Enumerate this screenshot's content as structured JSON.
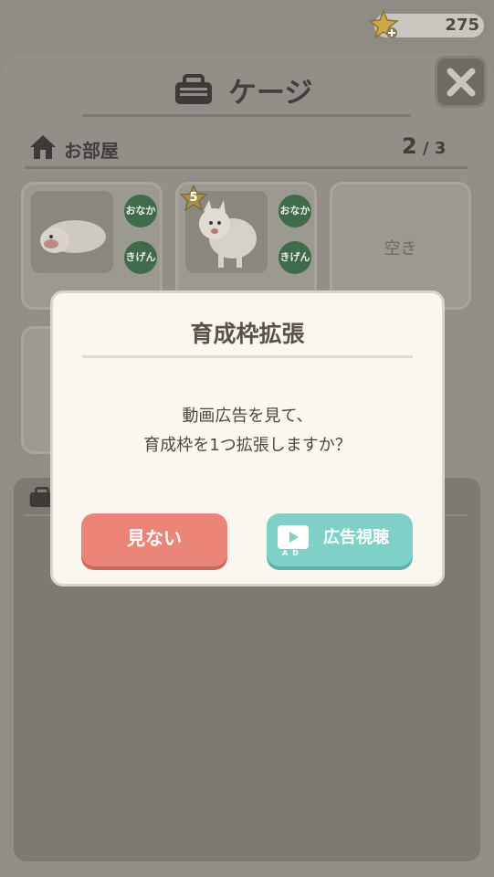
{
  "currency": {
    "icon": "star-icon",
    "count": "275"
  },
  "header": {
    "title": "ケージ",
    "close_icon": "close-icon"
  },
  "room": {
    "label": "お部屋",
    "current": "2",
    "max": "3",
    "slots": [
      {
        "status": [
          "おなか",
          "きげん"
        ]
      },
      {
        "level": "5",
        "status": [
          "おなか",
          "きげん"
        ]
      },
      {
        "empty_label": "空き"
      }
    ]
  },
  "modal": {
    "title": "育成枠拡張",
    "message_line1": "動画広告を見て、",
    "message_line2": "育成枠を1つ拡張しますか？",
    "no_button": "見ない",
    "ad_button": "広告視聴",
    "ad_badge": "AD"
  },
  "colors": {
    "cancel": "#ea8578",
    "confirm": "#7fd1c8",
    "overlay": "#8d8b84"
  }
}
